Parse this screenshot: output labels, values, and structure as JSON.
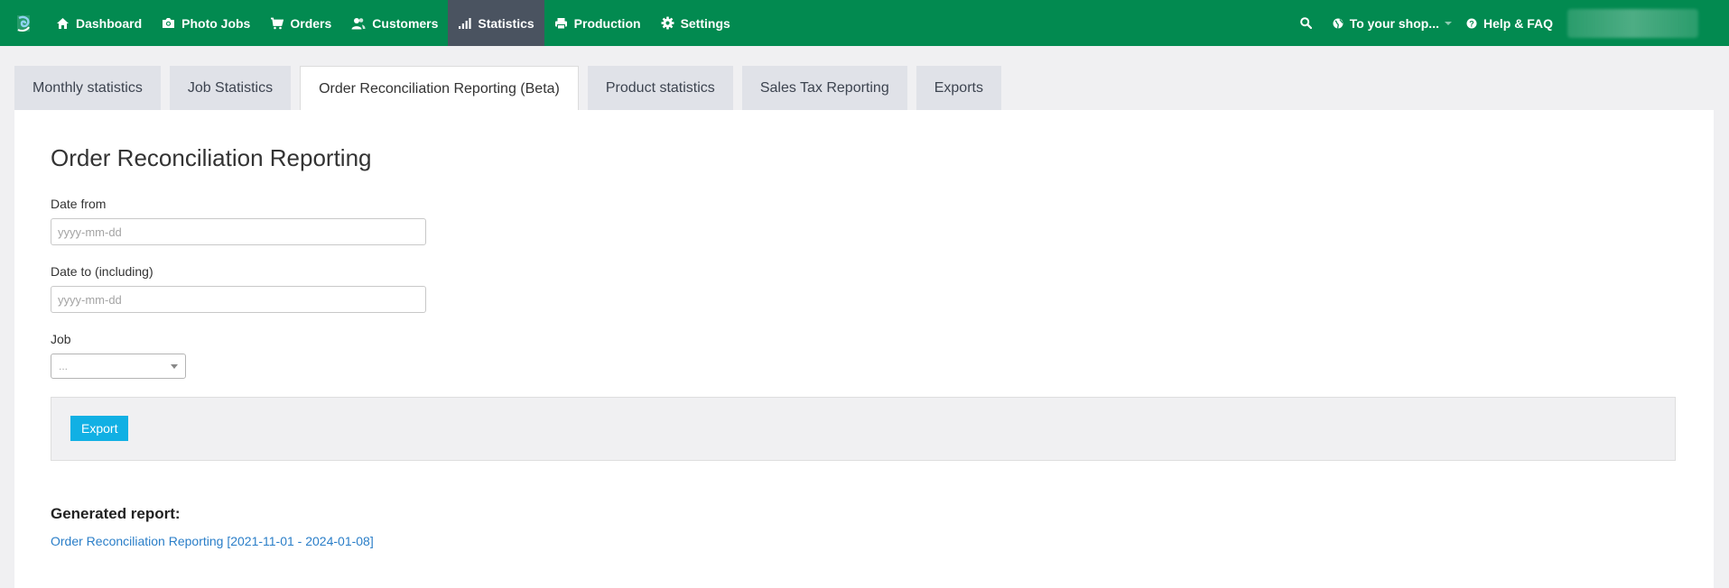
{
  "nav": {
    "items": [
      {
        "label": "Dashboard",
        "icon": "home-icon"
      },
      {
        "label": "Photo Jobs",
        "icon": "camera-icon"
      },
      {
        "label": "Orders",
        "icon": "cart-icon"
      },
      {
        "label": "Customers",
        "icon": "users-icon"
      },
      {
        "label": "Statistics",
        "icon": "bar-chart-icon",
        "active": true
      },
      {
        "label": "Production",
        "icon": "print-icon"
      },
      {
        "label": "Settings",
        "icon": "gear-icon"
      }
    ],
    "shop_label": "To your shop...",
    "help_label": "Help & FAQ"
  },
  "tabs": [
    {
      "label": "Monthly statistics"
    },
    {
      "label": "Job Statistics"
    },
    {
      "label": "Order Reconciliation Reporting (Beta)",
      "active": true
    },
    {
      "label": "Product statistics"
    },
    {
      "label": "Sales Tax Reporting"
    },
    {
      "label": "Exports"
    }
  ],
  "form": {
    "title": "Order Reconciliation Reporting",
    "date_from_label": "Date from",
    "date_from_placeholder": "yyyy-mm-dd",
    "date_from_value": "",
    "date_to_label": "Date to (including)",
    "date_to_placeholder": "yyyy-mm-dd",
    "date_to_value": "",
    "job_label": "Job",
    "job_value": "...",
    "export_label": "Export"
  },
  "report": {
    "heading": "Generated report:",
    "link_label": "Order Reconciliation Reporting [2021-11-01 - 2024-01-08]"
  },
  "colors": {
    "nav_bg": "#028a50",
    "nav_active": "#4a5360",
    "export_button": "#11b0e4",
    "link": "#2a7ec8"
  }
}
